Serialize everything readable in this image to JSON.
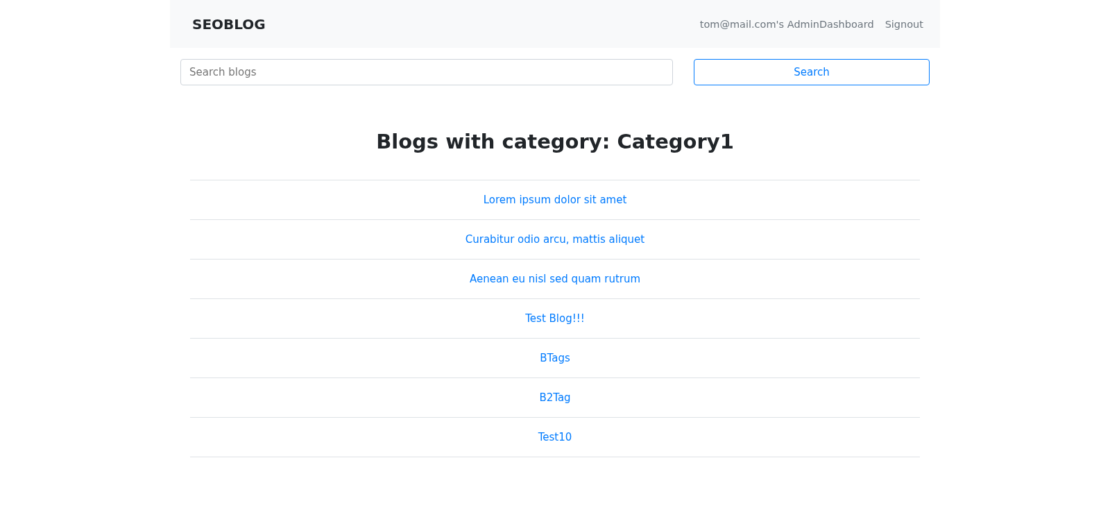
{
  "navbar": {
    "brand": "SEOBLOG",
    "links": [
      "tom@mail.com's AdminDashboard",
      "Signout"
    ]
  },
  "search": {
    "placeholder": "Search blogs",
    "button": "Search"
  },
  "heading": "Blogs with category: Category1",
  "blogs": [
    "Lorem ipsum dolor sit amet",
    "Curabitur odio arcu, mattis aliquet",
    "Aenean eu nisl sed quam rutrum",
    "Test Blog!!!",
    "BTags",
    "B2Tag",
    "Test10"
  ]
}
